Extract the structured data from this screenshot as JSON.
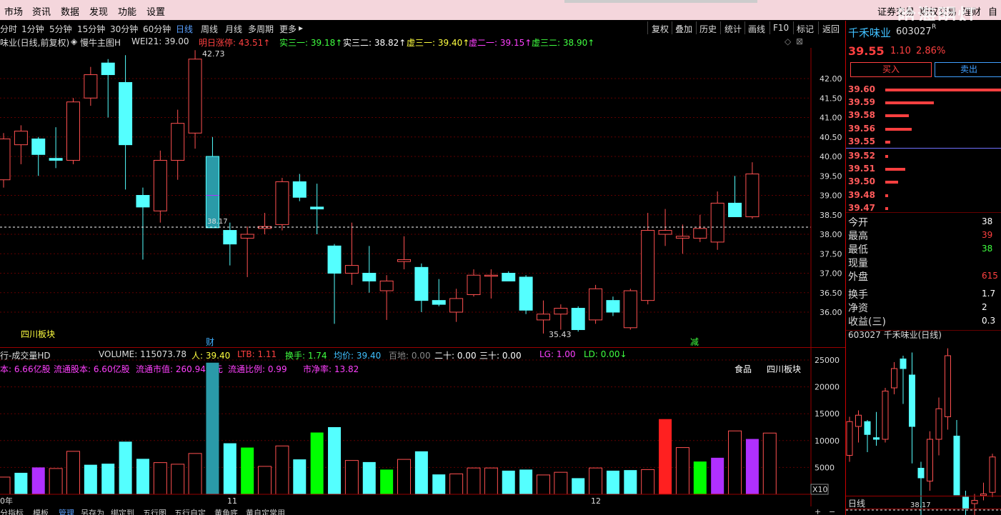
{
  "menubar": {
    "left_items": [
      "市场",
      "资讯",
      "数据",
      "发现",
      "功能",
      "设置"
    ],
    "right_items": [
      "证券交易",
      "期权交易",
      "理财",
      "自选"
    ],
    "watermark": "哈海明灯"
  },
  "toolbar": {
    "periods": [
      "分时",
      "1分钟",
      "5分钟",
      "15分钟",
      "30分钟",
      "60分钟",
      "日线",
      "周线",
      "月线",
      "多周期",
      "更多"
    ],
    "active_period": "日线",
    "right_buttons": [
      "复权",
      "叠加",
      "历史",
      "统计",
      "画线",
      "F10",
      "标记",
      "返回"
    ]
  },
  "chart_header": {
    "title": "味业(日线,前复权)",
    "indicator": "慢牛主图H",
    "items": [
      {
        "label": "WEI21:",
        "value": "39.00",
        "color": "#dddddd"
      },
      {
        "label": "明日涨停:",
        "value": "43.51",
        "color": "#ff4040"
      },
      {
        "label": "实三一:",
        "value": "39.18",
        "color": "#ffffff"
      },
      {
        "label": "实三二:",
        "value": "38.82",
        "color": "#ffffff"
      },
      {
        "label": "虚三一:",
        "value": "39.40",
        "color": "#ffff40"
      },
      {
        "label": "虚二一:",
        "value": "39.15",
        "color": "#ff40ff"
      },
      {
        "label": "虚三二:",
        "value": "38.90",
        "color": "#40ff40"
      }
    ]
  },
  "price_axis": {
    "ticks": [
      "42.00",
      "41.50",
      "41.00",
      "40.50",
      "40.00",
      "39.50",
      "39.00",
      "38.50",
      "38.00",
      "37.50",
      "37.00",
      "36.50",
      "36.00"
    ]
  },
  "annotations": {
    "high_label": "42.73",
    "low_label": "35.43",
    "ref_line_label": "38.17",
    "cai": "财",
    "jian": "减",
    "sector_tag": "四川板块"
  },
  "volume_header": {
    "title": "行-成交量HD",
    "volume": "VOLUME: 115073.78",
    "ren": "人: 39.40",
    "ltb": "LTB: 1.11",
    "huanshou": "换手: 1.74",
    "junjia": "均价: 39.40",
    "baidi": "百地: 0.00",
    "ershi": "二十: 0.00",
    "sanshi": "三十: 0.00",
    "lg": "LG: 1.00",
    "ld": "LD: 0.00",
    "line2": [
      "本: 6.66亿股",
      "流通股本: 6.60亿股",
      "流通市值: 260.94亿元",
      "流通比例: 0.99",
      "市净率: 13.82"
    ],
    "tags": [
      "食品",
      "四川板块"
    ]
  },
  "volume_axis": {
    "ticks": [
      "25000",
      "20000",
      "15000",
      "10000",
      "5000"
    ],
    "unit": "X10"
  },
  "dates": {
    "left": "0年",
    "m11": "11",
    "m12": "12"
  },
  "bottom_tabs": [
    "分指标",
    "模板",
    "管理",
    "另存为",
    "绑定到",
    "五行图",
    "五行自定",
    "黄角底",
    "黄自定常用"
  ],
  "right_panel": {
    "name": "千禾味业",
    "code": "603027",
    "flag": "R",
    "price": "39.55",
    "change": "1.10",
    "pct": "2.86%",
    "buy": "买入",
    "sell": "卖出",
    "order_book": [
      {
        "price": "39.60",
        "size": 1.0
      },
      {
        "price": "39.59",
        "size": 0.42
      },
      {
        "price": "39.58",
        "size": 0.2
      },
      {
        "price": "39.56",
        "size": 0.23
      },
      {
        "price": "39.55",
        "size": 0.04
      },
      {
        "price": "39.52",
        "size": 0.02
      },
      {
        "price": "39.51",
        "size": 0.17
      },
      {
        "price": "39.50",
        "size": 0.11
      },
      {
        "price": "39.48",
        "size": 0.02
      },
      {
        "price": "39.47",
        "size": 0.02
      }
    ],
    "stats": [
      {
        "label": "今开",
        "value": "38",
        "color": "#ffffff"
      },
      {
        "label": "最高",
        "value": "39",
        "color": "#ff4040"
      },
      {
        "label": "最低",
        "value": "38",
        "color": "#40ff40"
      },
      {
        "label": "现量",
        "value": "",
        "color": "#ffffff"
      },
      {
        "label": "外盘",
        "value": "615",
        "color": "#ff4040"
      },
      {
        "label": "换手",
        "value": "1.7",
        "color": "#ffffff"
      },
      {
        "label": "净资",
        "value": "2",
        "color": "#ffffff"
      },
      {
        "label": "收益(三)",
        "value": "0.3",
        "color": "#ffffff"
      }
    ],
    "mini_title": "603027 千禾味业(日线)",
    "mini_label": "38.17",
    "mini_period": "日线"
  },
  "candles": [
    {
      "o": 39.4,
      "h": 40.6,
      "l": 39.2,
      "c": 40.45
    },
    {
      "o": 40.3,
      "h": 40.8,
      "l": 39.8,
      "c": 40.65
    },
    {
      "o": 40.45,
      "h": 40.5,
      "l": 39.5,
      "c": 40.05
    },
    {
      "o": 39.95,
      "h": 40.75,
      "l": 39.7,
      "c": 39.9
    },
    {
      "o": 39.9,
      "h": 41.5,
      "l": 39.8,
      "c": 41.4
    },
    {
      "o": 41.5,
      "h": 42.3,
      "l": 41.3,
      "c": 42.1
    },
    {
      "o": 42.4,
      "h": 42.5,
      "l": 41.0,
      "c": 42.1
    },
    {
      "o": 41.9,
      "h": 42.6,
      "l": 39.15,
      "c": 40.3
    },
    {
      "o": 39.0,
      "h": 39.2,
      "l": 37.35,
      "c": 38.7
    },
    {
      "o": 38.6,
      "h": 40.15,
      "l": 38.3,
      "c": 39.9
    },
    {
      "o": 39.9,
      "h": 41.2,
      "l": 39.4,
      "c": 40.85
    },
    {
      "o": 40.6,
      "h": 42.73,
      "l": 40.2,
      "c": 42.5
    },
    {
      "o": 40.0,
      "h": 40.5,
      "l": 38.17,
      "c": 38.17
    },
    {
      "o": 38.1,
      "h": 38.3,
      "l": 37.2,
      "c": 37.75
    },
    {
      "o": 37.9,
      "h": 38.2,
      "l": 36.9,
      "c": 38.0
    },
    {
      "o": 38.15,
      "h": 38.55,
      "l": 38.0,
      "c": 38.2
    },
    {
      "o": 38.25,
      "h": 39.45,
      "l": 38.1,
      "c": 39.35
    },
    {
      "o": 39.35,
      "h": 39.55,
      "l": 38.85,
      "c": 38.95
    },
    {
      "o": 38.7,
      "h": 39.3,
      "l": 38.0,
      "c": 38.65
    },
    {
      "o": 37.7,
      "h": 37.75,
      "l": 35.7,
      "c": 37.0
    },
    {
      "o": 37.0,
      "h": 38.3,
      "l": 36.7,
      "c": 37.2
    },
    {
      "o": 37.0,
      "h": 37.7,
      "l": 36.5,
      "c": 36.8
    },
    {
      "o": 36.55,
      "h": 36.95,
      "l": 35.8,
      "c": 36.8
    },
    {
      "o": 37.3,
      "h": 37.95,
      "l": 37.1,
      "c": 37.35
    },
    {
      "o": 37.15,
      "h": 37.25,
      "l": 36.0,
      "c": 36.3
    },
    {
      "o": 36.3,
      "h": 36.85,
      "l": 36.15,
      "c": 36.2
    },
    {
      "o": 36.0,
      "h": 36.6,
      "l": 35.75,
      "c": 36.35
    },
    {
      "o": 36.45,
      "h": 37.1,
      "l": 36.4,
      "c": 36.95
    },
    {
      "o": 36.95,
      "h": 37.1,
      "l": 36.35,
      "c": 36.95
    },
    {
      "o": 37.0,
      "h": 37.05,
      "l": 36.8,
      "c": 36.8
    },
    {
      "o": 36.9,
      "h": 36.95,
      "l": 35.95,
      "c": 36.05
    },
    {
      "o": 35.8,
      "h": 36.3,
      "l": 35.45,
      "c": 35.95
    },
    {
      "o": 35.95,
      "h": 36.2,
      "l": 35.55,
      "c": 36.1
    },
    {
      "o": 36.1,
      "h": 36.15,
      "l": 35.5,
      "c": 35.55
    },
    {
      "o": 35.8,
      "h": 36.7,
      "l": 35.7,
      "c": 36.6
    },
    {
      "o": 36.3,
      "h": 36.4,
      "l": 35.9,
      "c": 36.0
    },
    {
      "o": 35.6,
      "h": 36.6,
      "l": 35.55,
      "c": 36.55
    },
    {
      "o": 36.3,
      "h": 38.55,
      "l": 36.2,
      "c": 38.1
    },
    {
      "o": 38.0,
      "h": 38.65,
      "l": 37.7,
      "c": 38.1
    },
    {
      "o": 37.9,
      "h": 38.25,
      "l": 37.5,
      "c": 37.95
    },
    {
      "o": 37.9,
      "h": 38.5,
      "l": 37.8,
      "c": 38.15
    },
    {
      "o": 37.8,
      "h": 39.1,
      "l": 37.6,
      "c": 38.8
    },
    {
      "o": 38.8,
      "h": 39.5,
      "l": 38.5,
      "c": 38.45
    },
    {
      "o": 38.45,
      "h": 39.85,
      "l": 38.4,
      "c": 39.55
    }
  ],
  "volumes": [
    3200,
    4000,
    5000,
    4800,
    8000,
    5500,
    5700,
    9800,
    6600,
    5900,
    5600,
    7600,
    24500,
    9500,
    8700,
    5200,
    9000,
    6500,
    11500,
    12500,
    6300,
    6000,
    4600,
    6500,
    8000,
    3700,
    3800,
    4900,
    4900,
    4400,
    4600,
    3600,
    4100,
    3000,
    4900,
    4400,
    4500,
    4600,
    14000,
    8700,
    6100,
    6800,
    11800,
    10300,
    11400
  ],
  "volume_colors": [
    "pink",
    "cyan",
    "purple",
    "pink",
    "pink",
    "cyan",
    "cyan",
    "cyan",
    "cyan",
    "pink",
    "pink",
    "pink",
    "teal",
    "cyan",
    "green",
    "pink",
    "pink",
    "cyan",
    "green",
    "cyan",
    "pink",
    "cyan",
    "green",
    "pink",
    "cyan",
    "cyan",
    "pink",
    "pink",
    "pink",
    "cyan",
    "cyan",
    "pink",
    "pink",
    "cyan",
    "pink",
    "cyan",
    "cyan",
    "pink",
    "red",
    "pink",
    "green",
    "purple",
    "pink",
    "purple",
    "pink"
  ],
  "colors": {
    "up": "#ff5050",
    "down": "#54ffff",
    "green": "#00ff00",
    "purple": "#b030ff",
    "teal": "#2a9aa8",
    "red": "#ff2020",
    "grid": "#600000"
  }
}
